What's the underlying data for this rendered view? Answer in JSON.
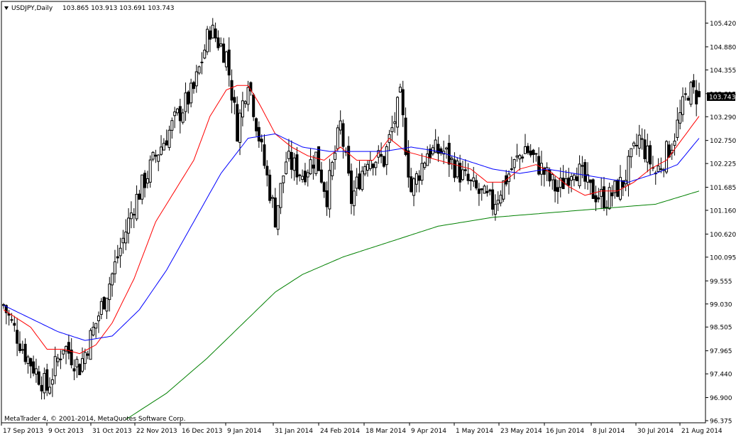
{
  "header": {
    "symbol_timeframe": "USDJPY,Daily",
    "ohlc": "103.865 103.913 103.691 103.743"
  },
  "footer": {
    "copyright": "MetaTrader 4, © 2001-2014, MetaQuotes Software Corp."
  },
  "price_marker": "103.743",
  "colors": {
    "background": "#ffffff",
    "candle": "#000000",
    "ma_fast": "#ff0000",
    "ma_mid": "#0000ff",
    "ma_slow": "#008000"
  },
  "chart_data": {
    "type": "candlestick",
    "symbol": "USDJPY",
    "timeframe": "Daily",
    "ylim": [
      96.375,
      105.7
    ],
    "y_ticks": [
      "105.420",
      "104.880",
      "104.355",
      "103.815",
      "103.290",
      "102.750",
      "102.225",
      "101.685",
      "101.160",
      "100.620",
      "100.095",
      "99.555",
      "99.030",
      "98.505",
      "97.965",
      "97.440",
      "96.900",
      "96.375"
    ],
    "x_ticks": [
      "17 Sep 2013",
      "9 Oct 2013",
      "31 Oct 2013",
      "22 Nov 2013",
      "16 Dec 2013",
      "9 Jan 2014",
      "31 Jan 2014",
      "24 Feb 2014",
      "18 Mar 2014",
      "9 Apr 2014",
      "1 May 2014",
      "23 May 2014",
      "16 Jun 2014",
      "8 Jul 2014",
      "30 Jul 2014",
      "21 Aug 2014"
    ],
    "last_close": 103.743,
    "ohlc_key": [
      {
        "bar": 0,
        "close": 99.0
      },
      {
        "bar": 8,
        "close": 97.9
      },
      {
        "bar": 16,
        "close": 97.1
      },
      {
        "bar": 22,
        "close": 98.1
      },
      {
        "bar": 28,
        "close": 97.6
      },
      {
        "bar": 34,
        "close": 98.6
      },
      {
        "bar": 40,
        "close": 99.7
      },
      {
        "bar": 48,
        "close": 101.3
      },
      {
        "bar": 56,
        "close": 102.4
      },
      {
        "bar": 64,
        "close": 103.3
      },
      {
        "bar": 70,
        "close": 103.9
      },
      {
        "bar": 76,
        "close": 105.3
      },
      {
        "bar": 82,
        "close": 104.7
      },
      {
        "bar": 86,
        "close": 103.0
      },
      {
        "bar": 90,
        "close": 104.2
      },
      {
        "bar": 95,
        "close": 102.5
      },
      {
        "bar": 100,
        "close": 101.0
      },
      {
        "bar": 104,
        "close": 102.3
      },
      {
        "bar": 110,
        "close": 102.0
      },
      {
        "bar": 115,
        "close": 102.4
      },
      {
        "bar": 119,
        "close": 101.5
      },
      {
        "bar": 124,
        "close": 103.1
      },
      {
        "bar": 128,
        "close": 101.4
      },
      {
        "bar": 134,
        "close": 102.4
      },
      {
        "bar": 140,
        "close": 102.3
      },
      {
        "bar": 146,
        "close": 103.7
      },
      {
        "bar": 150,
        "close": 101.6
      },
      {
        "bar": 156,
        "close": 102.5
      },
      {
        "bar": 162,
        "close": 102.5
      },
      {
        "bar": 168,
        "close": 102.0
      },
      {
        "bar": 174,
        "close": 101.6
      },
      {
        "bar": 180,
        "close": 101.3
      },
      {
        "bar": 186,
        "close": 102.0
      },
      {
        "bar": 192,
        "close": 102.6
      },
      {
        "bar": 198,
        "close": 102.1
      },
      {
        "bar": 204,
        "close": 101.6
      },
      {
        "bar": 210,
        "close": 102.2
      },
      {
        "bar": 216,
        "close": 101.6
      },
      {
        "bar": 222,
        "close": 101.4
      },
      {
        "bar": 228,
        "close": 101.8
      },
      {
        "bar": 234,
        "close": 102.8
      },
      {
        "bar": 240,
        "close": 102.0
      },
      {
        "bar": 246,
        "close": 102.7
      },
      {
        "bar": 252,
        "close": 103.9
      },
      {
        "bar": 256,
        "close": 103.743
      }
    ],
    "ma_fast_key": [
      {
        "bar": 0,
        "value": 98.9
      },
      {
        "bar": 10,
        "value": 98.5
      },
      {
        "bar": 16,
        "value": 98.0
      },
      {
        "bar": 22,
        "value": 98.0
      },
      {
        "bar": 28,
        "value": 97.9
      },
      {
        "bar": 34,
        "value": 98.1
      },
      {
        "bar": 40,
        "value": 98.6
      },
      {
        "bar": 48,
        "value": 99.6
      },
      {
        "bar": 56,
        "value": 100.9
      },
      {
        "bar": 64,
        "value": 101.7
      },
      {
        "bar": 70,
        "value": 102.3
      },
      {
        "bar": 76,
        "value": 103.3
      },
      {
        "bar": 82,
        "value": 103.9
      },
      {
        "bar": 86,
        "value": 104.0
      },
      {
        "bar": 90,
        "value": 104.0
      },
      {
        "bar": 94,
        "value": 103.6
      },
      {
        "bar": 100,
        "value": 102.9
      },
      {
        "bar": 106,
        "value": 102.6
      },
      {
        "bar": 112,
        "value": 102.4
      },
      {
        "bar": 118,
        "value": 102.3
      },
      {
        "bar": 124,
        "value": 102.6
      },
      {
        "bar": 130,
        "value": 102.3
      },
      {
        "bar": 136,
        "value": 102.3
      },
      {
        "bar": 142,
        "value": 102.8
      },
      {
        "bar": 148,
        "value": 102.5
      },
      {
        "bar": 154,
        "value": 102.4
      },
      {
        "bar": 160,
        "value": 102.3
      },
      {
        "bar": 166,
        "value": 102.2
      },
      {
        "bar": 172,
        "value": 102.1
      },
      {
        "bar": 178,
        "value": 101.8
      },
      {
        "bar": 184,
        "value": 101.8
      },
      {
        "bar": 190,
        "value": 102.1
      },
      {
        "bar": 196,
        "value": 102.2
      },
      {
        "bar": 202,
        "value": 102.0
      },
      {
        "bar": 208,
        "value": 101.7
      },
      {
        "bar": 214,
        "value": 101.5
      },
      {
        "bar": 220,
        "value": 101.6
      },
      {
        "bar": 226,
        "value": 101.6
      },
      {
        "bar": 232,
        "value": 101.8
      },
      {
        "bar": 238,
        "value": 102.1
      },
      {
        "bar": 244,
        "value": 102.3
      },
      {
        "bar": 250,
        "value": 102.8
      },
      {
        "bar": 256,
        "value": 103.3
      }
    ],
    "ma_mid_key": [
      {
        "bar": 0,
        "value": 99.0
      },
      {
        "bar": 10,
        "value": 98.7
      },
      {
        "bar": 20,
        "value": 98.4
      },
      {
        "bar": 30,
        "value": 98.2
      },
      {
        "bar": 40,
        "value": 98.3
      },
      {
        "bar": 50,
        "value": 98.9
      },
      {
        "bar": 60,
        "value": 99.8
      },
      {
        "bar": 70,
        "value": 100.9
      },
      {
        "bar": 80,
        "value": 102.0
      },
      {
        "bar": 90,
        "value": 102.8
      },
      {
        "bar": 100,
        "value": 102.9
      },
      {
        "bar": 110,
        "value": 102.6
      },
      {
        "bar": 120,
        "value": 102.5
      },
      {
        "bar": 130,
        "value": 102.5
      },
      {
        "bar": 140,
        "value": 102.5
      },
      {
        "bar": 150,
        "value": 102.6
      },
      {
        "bar": 160,
        "value": 102.5
      },
      {
        "bar": 170,
        "value": 102.3
      },
      {
        "bar": 180,
        "value": 102.1
      },
      {
        "bar": 190,
        "value": 102.0
      },
      {
        "bar": 200,
        "value": 102.1
      },
      {
        "bar": 210,
        "value": 102.0
      },
      {
        "bar": 220,
        "value": 101.9
      },
      {
        "bar": 230,
        "value": 101.8
      },
      {
        "bar": 240,
        "value": 102.0
      },
      {
        "bar": 248,
        "value": 102.2
      },
      {
        "bar": 256,
        "value": 102.8
      }
    ],
    "ma_slow_key": [
      {
        "bar": 45,
        "value": 96.4
      },
      {
        "bar": 60,
        "value": 97.0
      },
      {
        "bar": 75,
        "value": 97.8
      },
      {
        "bar": 90,
        "value": 98.7
      },
      {
        "bar": 100,
        "value": 99.3
      },
      {
        "bar": 110,
        "value": 99.7
      },
      {
        "bar": 125,
        "value": 100.1
      },
      {
        "bar": 140,
        "value": 100.4
      },
      {
        "bar": 160,
        "value": 100.8
      },
      {
        "bar": 180,
        "value": 101.0
      },
      {
        "bar": 200,
        "value": 101.1
      },
      {
        "bar": 220,
        "value": 101.2
      },
      {
        "bar": 240,
        "value": 101.3
      },
      {
        "bar": 256,
        "value": 101.6
      }
    ]
  }
}
